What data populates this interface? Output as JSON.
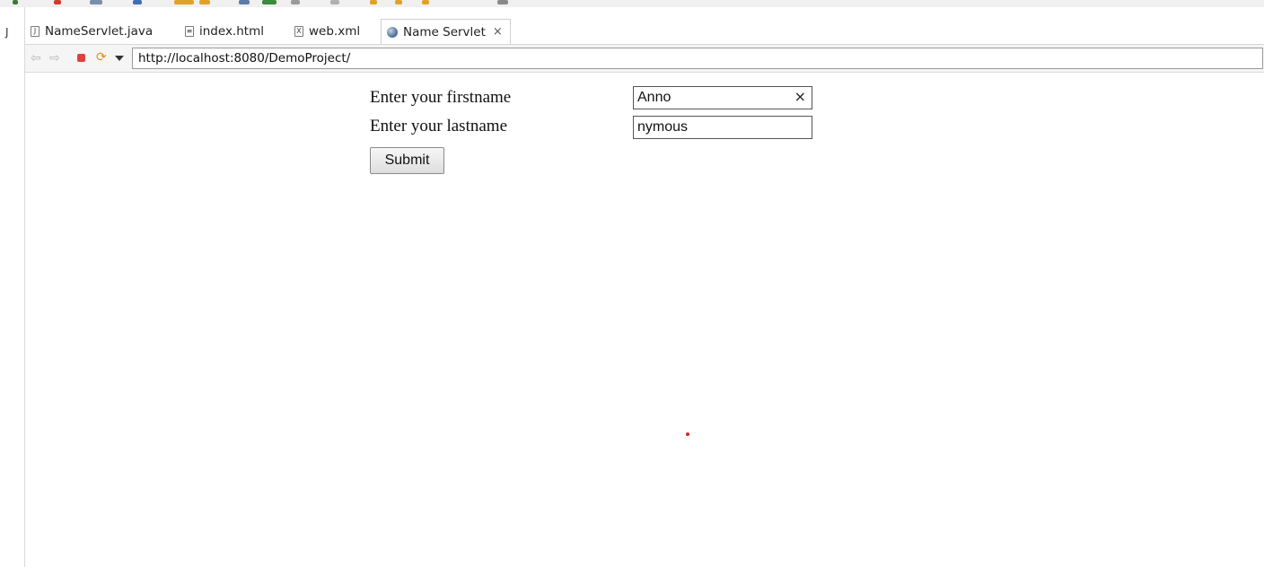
{
  "gutter": {
    "glyph": "J"
  },
  "tabs": [
    {
      "label": "NameServlet.java",
      "icon": "java-file-icon",
      "icon_glyph": "J"
    },
    {
      "label": "index.html",
      "icon": "html-file-icon",
      "icon_glyph": "≡"
    },
    {
      "label": "web.xml",
      "icon": "xml-file-icon",
      "icon_glyph": "X"
    },
    {
      "label": "Name Servlet",
      "icon": "globe-icon",
      "active": true,
      "close": "×"
    }
  ],
  "nav": {
    "back": "⇦",
    "forward": "⇨",
    "refresh": "⟳",
    "url": "http://localhost:8080/DemoProject/"
  },
  "form": {
    "firstname_label": "Enter your firstname",
    "firstname_value": "Anno",
    "clear_glyph": "×",
    "lastname_label": "Enter your lastname",
    "lastname_value": "nymous",
    "submit_label": "Submit"
  },
  "colors": {
    "stop": "#e0413b",
    "refresh": "#e38d1c",
    "dot": "#d0262d"
  }
}
